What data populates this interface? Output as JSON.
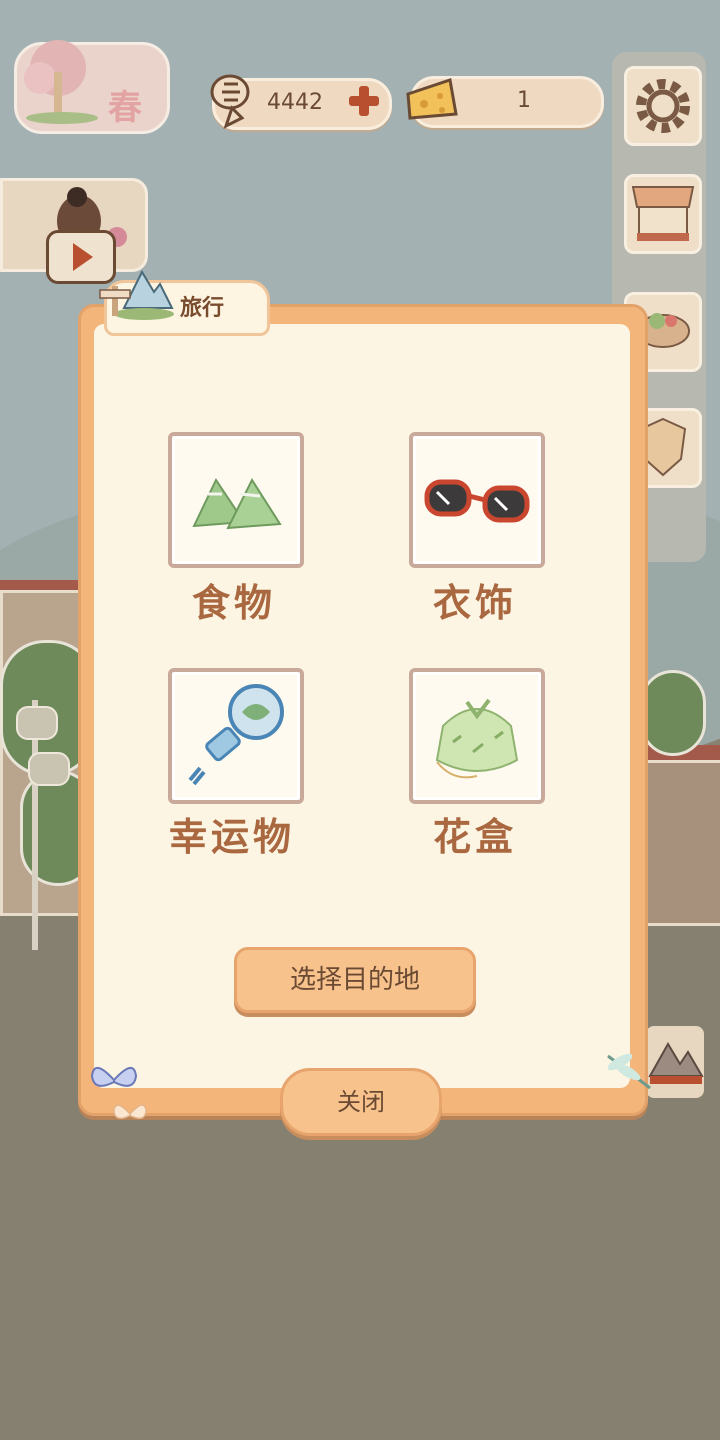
{
  "hud": {
    "season": "春",
    "fish_count": "4442",
    "cheese_count": "1"
  },
  "modal": {
    "tab_title": "旅行",
    "categories": [
      {
        "label": "食物",
        "icon": "rice-dumpling-icon"
      },
      {
        "label": "衣饰",
        "icon": "sunglasses-icon"
      },
      {
        "label": "幸运物",
        "icon": "lucky-charm-icon"
      },
      {
        "label": "花盒",
        "icon": "wrapped-bundle-icon"
      }
    ],
    "select_destination_label": "选择目的地",
    "close_label": "关闭"
  },
  "colors": {
    "modal_border": "#f4b57a",
    "modal_fill": "#fdf5e4",
    "label_text": "#a9683f",
    "button_fill": "#f7c28b"
  }
}
